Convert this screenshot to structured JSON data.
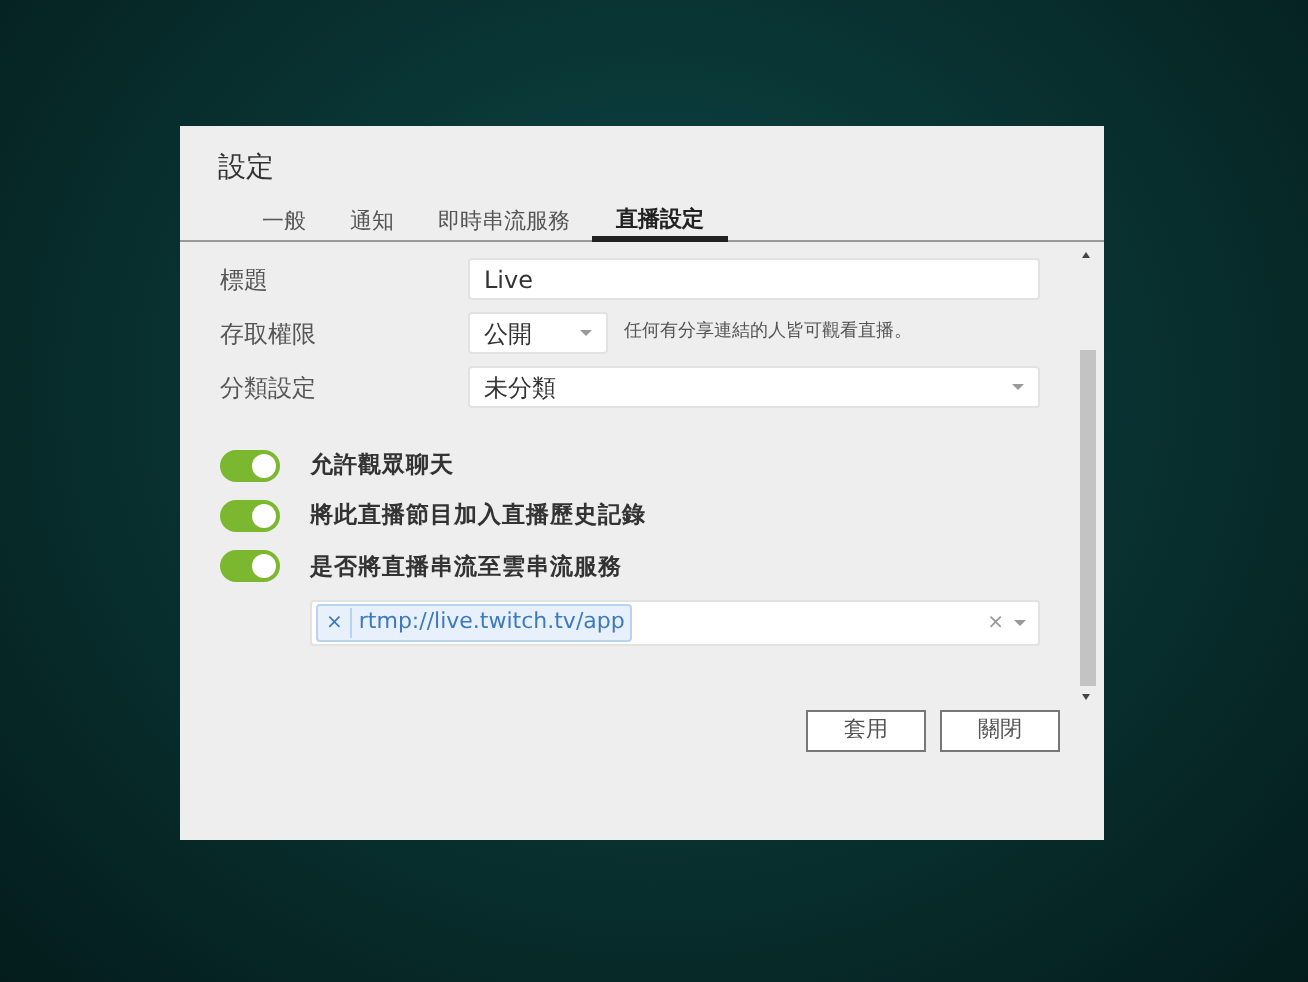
{
  "dialog": {
    "title": "設定",
    "tabs": [
      {
        "label": "一般",
        "selected": false
      },
      {
        "label": "通知",
        "selected": false
      },
      {
        "label": "即時串流服務",
        "selected": false
      },
      {
        "label": "直播設定",
        "selected": true
      }
    ],
    "fields": [
      {
        "kind": "text",
        "label": "標題",
        "value": "Live"
      },
      {
        "kind": "select",
        "label": "存取權限",
        "value": "公開",
        "hint": "任何有分享連結的人皆可觀看直播。"
      },
      {
        "kind": "select",
        "label": "分類設定",
        "value": "未分類"
      }
    ],
    "toggles": [
      {
        "label": "允許觀眾聊天",
        "on": true
      },
      {
        "label": "將此直播節目加入直播歷史記錄",
        "on": true
      },
      {
        "label": "是否將直播串流至雲串流服務",
        "on": true
      }
    ],
    "stream_targets": {
      "tags": [
        {
          "remove": "×",
          "text": "rtmp://live.twitch.tv/app"
        }
      ],
      "clear": "×"
    },
    "buttons": [
      "套用",
      "關閉"
    ]
  }
}
